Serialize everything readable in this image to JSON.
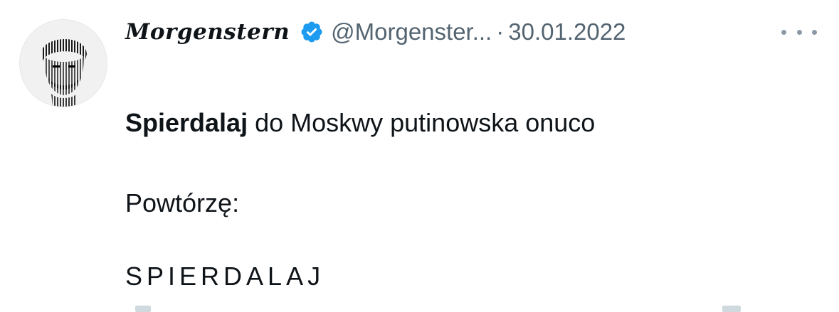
{
  "author": {
    "display_name": "Morgenstern",
    "handle": "@Morgenster...",
    "verified": true,
    "avatar_icon": "avatar-portrait-icon"
  },
  "meta": {
    "separator": "·",
    "date": "30.01.2022"
  },
  "menu": {
    "icon": "more-horizontal-icon"
  },
  "body": {
    "line1_bold": "Spierdalaj",
    "line1_rest": " do Moskwy putinowska onuco",
    "line2": "Powtórzę:",
    "line3": "SPIERDALAJ"
  },
  "colors": {
    "text": "#0f1419",
    "secondary": "#536471",
    "verified_badge": "#1d9bf0"
  }
}
